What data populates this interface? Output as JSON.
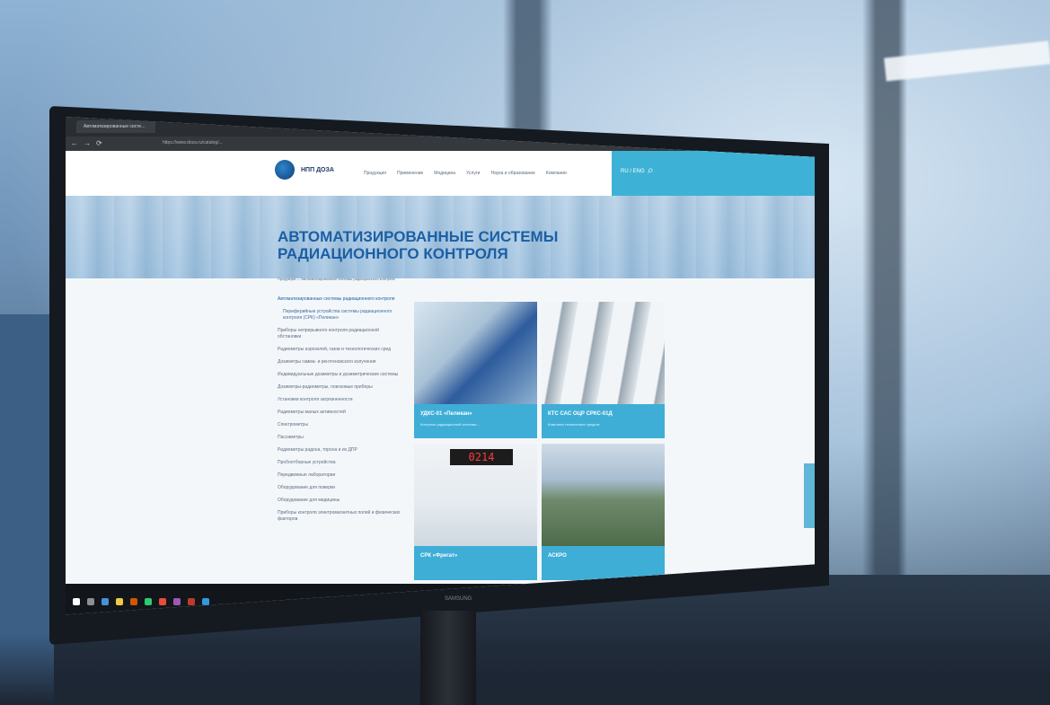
{
  "browser": {
    "tab_title": "Автоматизированные систе...",
    "url": "https://www.doza.ru/catalog/..."
  },
  "site": {
    "logo_text": "НПП ДОЗА",
    "nav": [
      "Продукция",
      "Применение",
      "Медицина",
      "Услуги",
      "Наука и образование",
      "Компания"
    ],
    "lang": "RU / ENG"
  },
  "hero": {
    "title": "АВТОМАТИЗИРОВАННЫЕ СИСТЕМЫ РАДИАЦИОННОГО КОНТРОЛЯ",
    "breadcrumb": "Продукция — Автоматизированные системы радиационного контроля"
  },
  "sidebar": {
    "items": [
      {
        "label": "Автоматизированные системы радиационного контроля",
        "type": "active"
      },
      {
        "label": "Периферийные устройства системы радиационного контроля (СРК) «Пеликан»",
        "type": "sub"
      },
      {
        "label": "Приборы непрерывного контроля радиационной обстановки",
        "type": "normal"
      },
      {
        "label": "Радиометры аэрозолей, газов и технологических сред",
        "type": "normal"
      },
      {
        "label": "Дозиметры гамма- и рентгеновского излучения",
        "type": "normal"
      },
      {
        "label": "Индивидуальные дозиметры и дозиметрические системы",
        "type": "normal"
      },
      {
        "label": "Дозиметры-радиометры, поисковые приборы",
        "type": "normal"
      },
      {
        "label": "Установки контроля загрязненности",
        "type": "normal"
      },
      {
        "label": "Радиометры малых активностей",
        "type": "normal"
      },
      {
        "label": "Спектрометры",
        "type": "normal"
      },
      {
        "label": "Пассиметры",
        "type": "normal"
      },
      {
        "label": "Радиометры радона, торона и их ДПР",
        "type": "normal"
      },
      {
        "label": "Пробоотборные устройства",
        "type": "normal"
      },
      {
        "label": "Передвижные лаборатории",
        "type": "normal"
      },
      {
        "label": "Оборудование для поверки",
        "type": "normal"
      },
      {
        "label": "Оборудование для медицины",
        "type": "normal"
      },
      {
        "label": "Приборы контроля электромагнитных полей и физических факторов",
        "type": "normal"
      }
    ]
  },
  "cards": [
    {
      "title": "УДКС-01 «Пеликан»",
      "subtitle": "Контроль радиационной системы..."
    },
    {
      "title": "КТС САС ОЦР СРКС-01Д",
      "subtitle": "Комплекс технических средств"
    },
    {
      "title": "СРК «Фрегат»",
      "subtitle": ""
    },
    {
      "title": "АСКРО",
      "subtitle": ""
    }
  ],
  "display": {
    "led_value": "0214",
    "monitor_brand": "SAMSUNG"
  },
  "colors": {
    "accent": "#3eb2d6",
    "title": "#1b5fa5"
  }
}
